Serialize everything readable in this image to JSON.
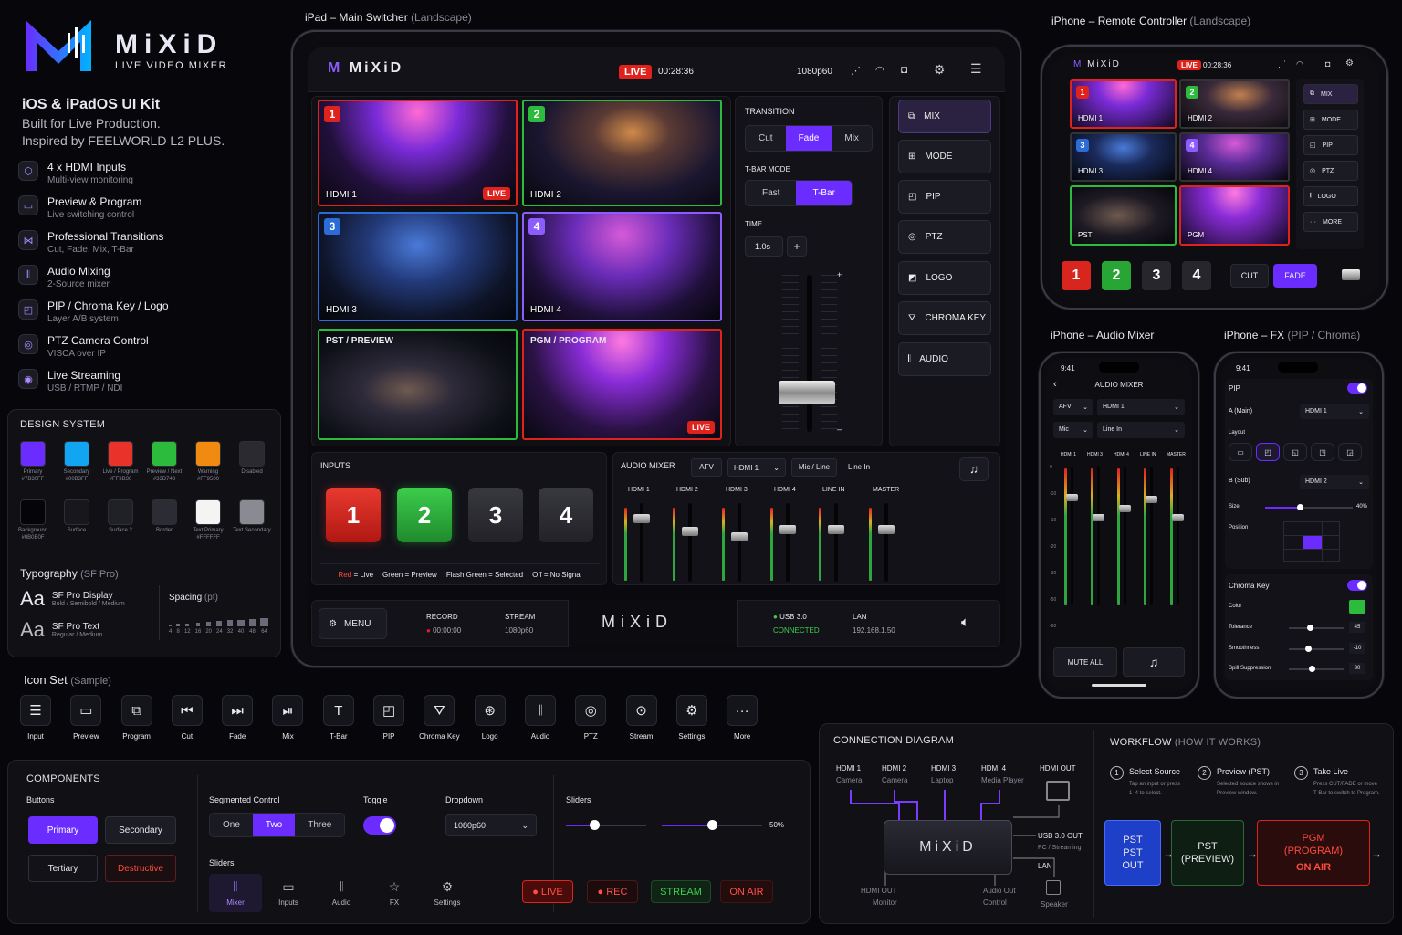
{
  "brand": {
    "name": "MiXiD",
    "tagline": "LIVE VIDEO MIXER",
    "kit": "iOS & iPadOS UI Kit",
    "sub1": "Built for Live Production.",
    "sub2": "Inspired by FEELWORLD L2 PLUS."
  },
  "features": [
    {
      "icon": "hdmi-icon",
      "title": "4 x HDMI Inputs",
      "desc": "Multi-view monitoring"
    },
    {
      "icon": "preview-icon",
      "title": "Preview & Program",
      "desc": "Live switching control"
    },
    {
      "icon": "transition-icon",
      "title": "Professional Transitions",
      "desc": "Cut, Fade, Mix, T-Bar"
    },
    {
      "icon": "audio-icon",
      "title": "Audio Mixing",
      "desc": "2-Source mixer"
    },
    {
      "icon": "pip-icon",
      "title": "PIP / Chroma Key / Logo",
      "desc": "Layer A/B system"
    },
    {
      "icon": "ptz-icon",
      "title": "PTZ Camera Control",
      "desc": "VISCA over IP"
    },
    {
      "icon": "stream-icon",
      "title": "Live Streaming",
      "desc": "USB / RTMP / NDI"
    }
  ],
  "design_system": {
    "title": "DESIGN SYSTEM",
    "row1": [
      {
        "name": "Primary",
        "hex": "#7B30FF"
      },
      {
        "name": "Secondary",
        "hex": "#00B3FF"
      },
      {
        "name": "Live / Program",
        "hex": "#FF3B30"
      },
      {
        "name": "Preview / Next",
        "hex": "#33D748"
      },
      {
        "name": "Warning",
        "hex": "#FF9500"
      },
      {
        "name": "Disabled",
        "hex": ""
      }
    ],
    "row1_colors": [
      "#6a2cff",
      "#11a5f2",
      "#e8322a",
      "#2cbb3c",
      "#f08a10",
      "#2a2a30"
    ],
    "row2": [
      {
        "name": "Background",
        "hex": "#0B0B0F"
      },
      {
        "name": "Surface",
        "hex": ""
      },
      {
        "name": "Surface 2",
        "hex": ""
      },
      {
        "name": "Border",
        "hex": ""
      },
      {
        "name": "Text Primary",
        "hex": "#FFFFFF"
      },
      {
        "name": "Text Secondary",
        "hex": ""
      }
    ],
    "row2_colors": [
      "#050507",
      "#17171c",
      "#202027",
      "#2c2c34",
      "#f4f4f4",
      "#8a8a92"
    ],
    "typo_title": "Typography",
    "typo_sub": "(SF Pro)",
    "typo": [
      {
        "aa": "Aa",
        "name": "SF Pro Display",
        "w": "Bold / Semibold / Medium"
      },
      {
        "aa": "Aa",
        "name": "SF Pro Text",
        "w": "Regular / Medium"
      }
    ],
    "spacing_title": "Spacing",
    "spacing_sub": "(pt)",
    "spacing": [
      "4",
      "8",
      "12",
      "16",
      "20",
      "24",
      "32",
      "40",
      "48",
      "64"
    ]
  },
  "icon_set": {
    "title": "Icon Set",
    "sub": "(Sample)",
    "items": [
      {
        "icon": "input-icon",
        "label": "Input"
      },
      {
        "icon": "folder-icon",
        "label": "Preview"
      },
      {
        "icon": "program-icon",
        "label": "Program"
      },
      {
        "icon": "cut-icon",
        "label": "Cut"
      },
      {
        "icon": "fade-icon",
        "label": "Fade"
      },
      {
        "icon": "mix-icon",
        "label": "Mix"
      },
      {
        "icon": "tbar-icon",
        "label": "T-Bar"
      },
      {
        "icon": "pip-icon",
        "label": "PIP"
      },
      {
        "icon": "chroma-icon",
        "label": "Chroma Key"
      },
      {
        "icon": "logo-icon",
        "label": "Logo"
      },
      {
        "icon": "audio-icon",
        "label": "Audio"
      },
      {
        "icon": "ptz-icon",
        "label": "PTZ"
      },
      {
        "icon": "stream-icon",
        "label": "Stream"
      },
      {
        "icon": "gear-icon",
        "label": "Settings"
      },
      {
        "icon": "more-icon",
        "label": "More"
      }
    ]
  },
  "components": {
    "title": "COMPONENTS",
    "buttons_title": "Buttons",
    "primary": "Primary",
    "secondary": "Secondary",
    "tertiary": "Tertiary",
    "destructive": "Destructive",
    "seg_title": "Segmented Control",
    "seg": [
      "One",
      "Two",
      "Three"
    ],
    "toggle_title": "Toggle",
    "dropdown_title": "Dropdown",
    "dropdown_value": "1080p60",
    "sliders_title": "Sliders",
    "slider_pct": "50%",
    "slider1": 0.35,
    "slider2": 0.5,
    "tabs_title": "Sliders",
    "tabs": [
      {
        "icon": "mixer-icon",
        "label": "Mixer"
      },
      {
        "icon": "folder-icon",
        "label": "Inputs"
      },
      {
        "icon": "audio-icon",
        "label": "Audio"
      },
      {
        "icon": "star-icon",
        "label": "FX"
      },
      {
        "icon": "gear-icon",
        "label": "Settings"
      }
    ],
    "badges": [
      "● LIVE",
      "● REC",
      "STREAM",
      "ON AIR"
    ]
  },
  "ipad": {
    "heading": "iPad – Main Switcher",
    "heading_sub": "(Landscape)",
    "live": "LIVE",
    "timer": "00:28:36",
    "format": "1080p60",
    "tiles": [
      {
        "n": "1",
        "label": "HDMI 1"
      },
      {
        "n": "2",
        "label": "HDMI 2"
      },
      {
        "n": "3",
        "label": "HDMI 3"
      },
      {
        "n": "4",
        "label": "HDMI 4"
      },
      {
        "n": "",
        "label": "PST / PREVIEW"
      },
      {
        "n": "",
        "label": "PGM / PROGRAM"
      }
    ],
    "transition_title": "TRANSITION",
    "transitions": [
      "Cut",
      "Fade",
      "Mix"
    ],
    "tbar_title": "T-BAR MODE",
    "tbar_modes": [
      "Fast",
      "T-Bar"
    ],
    "time_title": "TIME",
    "time_value": "1.0s",
    "plus": "+",
    "tbar_plus": "+",
    "tbar_minus": "–",
    "side": [
      "MIX",
      "MODE",
      "PIP",
      "PTZ",
      "LOGO",
      "CHROMA KEY",
      "AUDIO"
    ],
    "inputs_title": "INPUTS",
    "inputs": [
      "1",
      "2",
      "3",
      "4"
    ],
    "legend": [
      {
        "k": "Red",
        "v": " = Live"
      },
      {
        "k": "Green",
        "v": " = Preview"
      },
      {
        "k": "Flash Green",
        "v": " = Selected"
      },
      {
        "k": "Off",
        "v": " = No Signal"
      }
    ],
    "audio_title": "AUDIO MIXER",
    "audio_opts": [
      "AFV",
      "HDMI 1",
      "Mic / Line",
      "Line In"
    ],
    "channels": [
      "HDMI 1",
      "HDMI 2",
      "HDMI 3",
      "HDMI 4",
      "LINE IN",
      "MASTER"
    ],
    "bottom": {
      "menu": "MENU",
      "record": "RECORD",
      "record_time": "● 00:00:00",
      "stream": "STREAM",
      "stream_fmt": "1080p60",
      "usb": "● USB 3.0",
      "connected": "CONNECTED",
      "lan": "LAN",
      "ip": "192.168.1.50"
    }
  },
  "remote": {
    "heading": "iPhone – Remote Controller",
    "heading_sub": "(Landscape)",
    "live": "LIVE",
    "timer": "00:28:36",
    "tiles": [
      "HDMI 1",
      "HDMI 2",
      "HDMI 3",
      "HDMI 4",
      "PST",
      "PGM"
    ],
    "side": [
      "MIX",
      "MODE",
      "PIP",
      "PTZ",
      "LOGO",
      "MORE"
    ],
    "nums": [
      "1",
      "2",
      "3",
      "4"
    ],
    "cut": "CUT",
    "fade": "FADE"
  },
  "audio_phone": {
    "heading": "iPhone – Audio Mixer",
    "time": "9:41",
    "title": "AUDIO MIXER",
    "afv": "AFV",
    "afv_src": "HDMI 1",
    "mic": "Mic",
    "mic_src": "Line In",
    "cols": [
      "HDMI 1",
      "HDMI 3",
      "HDMI 4",
      "LINE IN",
      "MASTER"
    ],
    "scale": [
      "0",
      "-10",
      "-10",
      "-20",
      "-30",
      "-50",
      "-60"
    ],
    "mute": "MUTE ALL"
  },
  "fx_phone": {
    "heading": "iPhone – FX",
    "heading_sub": "(PIP / Chroma)",
    "time": "9:41",
    "pip": "PIP",
    "a_main": "A (Main)",
    "a_src": "HDMI 1",
    "layout": "Layout",
    "b_sub": "B (Sub)",
    "b_src": "HDMI 2",
    "size": "Size",
    "size_val": "40%",
    "size_level": 0.4,
    "position": "Position",
    "chroma": "Chroma Key",
    "color": "Color",
    "tolerance": "Tolerance",
    "tol_val": "45",
    "smooth": "Smoothness",
    "smooth_val": "-10",
    "spill": "Spill Suppression",
    "spill_val": "30"
  },
  "connection": {
    "title": "CONNECTION DIAGRAM",
    "nodes": [
      {
        "a": "HDMI 1",
        "b": "Camera"
      },
      {
        "a": "HDMI 2",
        "b": "Camera"
      },
      {
        "a": "HDMI 3",
        "b": "Laptop"
      },
      {
        "a": "HDMI 4",
        "b": "Media Player"
      },
      {
        "a": "HDMI OUT",
        "b": ""
      }
    ],
    "usb": "USB 3.0 OUT",
    "usb_sub": "PC / Streaming",
    "lan": "LAN",
    "hdmi_out": "HDMI OUT",
    "monitor": "Monitor",
    "audio_out": "Audio Out",
    "control": "Control",
    "speaker": "Speaker"
  },
  "workflow": {
    "title": "WORKFLOW",
    "sub": "(HOW IT WORKS)",
    "steps": [
      {
        "n": "1",
        "t": "Select Source",
        "d1": "Tap an input or press",
        "d2": "1–4 to select."
      },
      {
        "n": "2",
        "t": "Preview (PST)",
        "d1": "Selected source shows in",
        "d2": "Preview window."
      },
      {
        "n": "3",
        "t": "Take Live",
        "d1": "Press CUT/FADE or move",
        "d2": "T-Bar to switch to Program."
      }
    ],
    "box1": [
      "PST",
      "PST",
      "OUT"
    ],
    "box2": [
      "PST",
      "(PREVIEW)"
    ],
    "box3": [
      "PGM",
      "(PROGRAM)",
      "ON AIR"
    ]
  }
}
